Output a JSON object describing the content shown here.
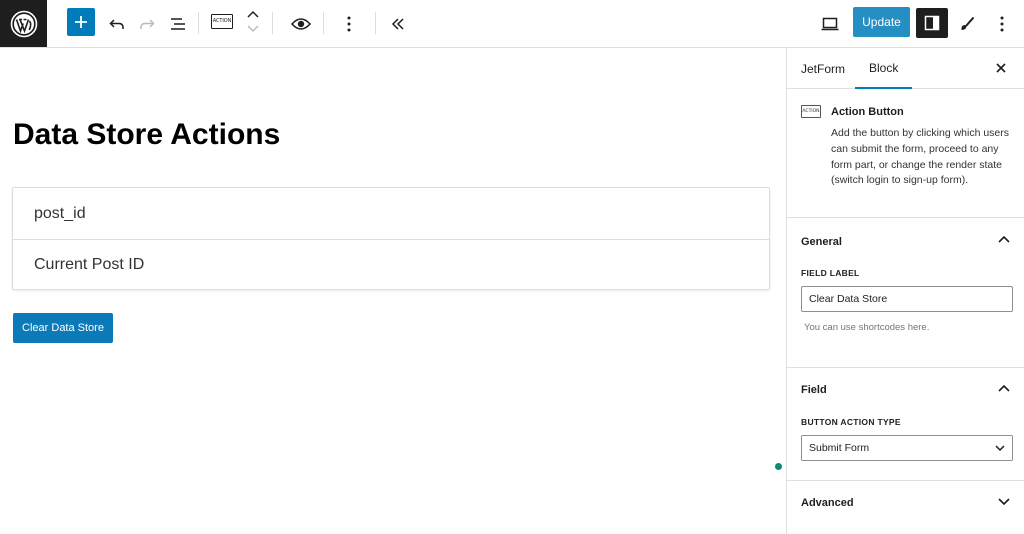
{
  "toolbar": {
    "action_icon_text": "ACTION",
    "update_label": "Update"
  },
  "canvas": {
    "title": "Data Store Actions",
    "fields": [
      "post_id",
      "Current Post ID"
    ],
    "button_label": "Clear Data Store"
  },
  "sidebar": {
    "tabs": [
      "JetForm",
      "Block"
    ],
    "block": {
      "icon_text": "ACTION",
      "name": "Action Button",
      "description": "Add the button by clicking which users can submit the form, proceed to any form part, or change the render state (switch login to sign-up form)."
    },
    "general": {
      "title": "General",
      "field_label_caption": "FIELD LABEL",
      "field_label_value": "Clear Data Store",
      "help": "You can use shortcodes here."
    },
    "field": {
      "title": "Field",
      "action_type_caption": "BUTTON ACTION TYPE",
      "action_type_value": "Submit Form"
    },
    "advanced": {
      "title": "Advanced"
    }
  },
  "colors": {
    "accent": "#007cba",
    "dark": "#1e1e1e",
    "status_dot": "#0a8a7a"
  },
  "icons": [
    "wordpress-logo",
    "plus-icon",
    "undo-icon",
    "redo-icon",
    "list-view-icon",
    "chevron-up-icon",
    "chevron-down-icon",
    "eye-icon",
    "more-vertical-icon",
    "collapse-icon",
    "desktop-icon",
    "settings-sidebar-icon",
    "brush-icon",
    "close-icon"
  ]
}
